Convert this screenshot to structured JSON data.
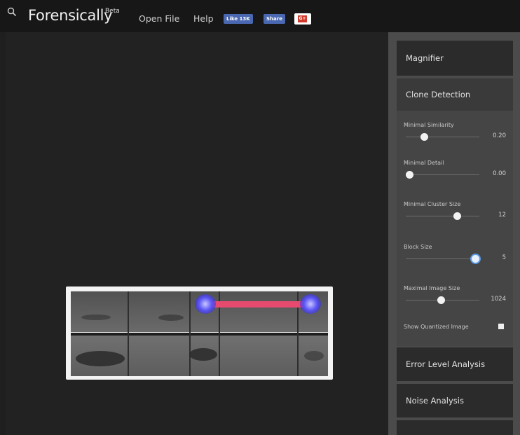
{
  "app": {
    "title": "Forensically",
    "title_suffix": "Beta"
  },
  "menu": {
    "open_file": "Open File",
    "help": "Help",
    "fb_like": "Like 13K",
    "fb_share": "Share",
    "gplus": "G+"
  },
  "sidebar": {
    "magnifier": "Magnifier",
    "clone_detection": "Clone Detection",
    "controls": [
      {
        "label": "Minimal Similarity",
        "value": "0.20",
        "level": 0.25
      },
      {
        "label": "Minimal Detail",
        "value": "0.00",
        "level": 0.0
      },
      {
        "label": "Minimal Cluster Size",
        "value": "12",
        "level": 0.7
      },
      {
        "label": "Block Size",
        "value": "5",
        "level": 0.95
      },
      {
        "label": "Maximal Image Size",
        "value": "1024",
        "level": 0.48
      }
    ],
    "show_quantized": "Show Quantized Image",
    "show_quantized_checked": false,
    "error_level_analysis": "Error Level Analysis",
    "noise_analysis": "Noise Analysis"
  },
  "colors": {
    "clone_line": "#e74a6f",
    "clone_blob": "#5a54f5",
    "accent_fb": "#4a68b1"
  },
  "icons": {
    "search": "search-icon"
  }
}
